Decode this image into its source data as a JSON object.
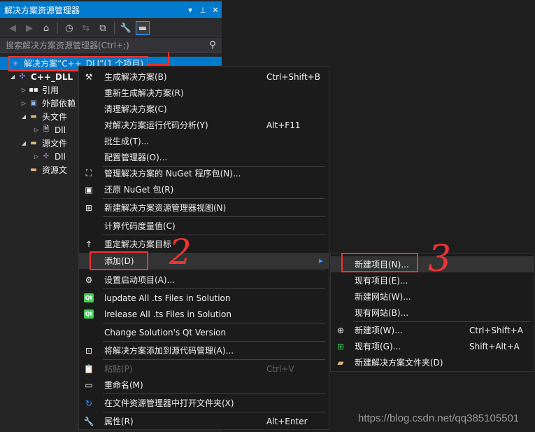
{
  "panel": {
    "title": "解决方案资源管理器",
    "title_buttons": [
      "▾",
      "⊥",
      "✕"
    ],
    "search_placeholder": "搜索解决方案资源管理器(Ctrl+;)"
  },
  "tree": [
    {
      "label": "解决方案“C++_DLL”(1 个项目)",
      "icon": "solution-icon"
    },
    {
      "label": "C++_DLL",
      "icon": "cpp-project-icon"
    },
    {
      "label": "引用",
      "icon": "references-icon"
    },
    {
      "label": "外部依赖",
      "icon": "external-deps-icon"
    },
    {
      "label": "头文件",
      "icon": "folder-icon"
    },
    {
      "label": "Dll",
      "icon": "header-file-icon"
    },
    {
      "label": "源文件",
      "icon": "folder-icon"
    },
    {
      "label": "Dll",
      "icon": "source-file-icon"
    },
    {
      "label": "资源文",
      "icon": "folder-icon"
    }
  ],
  "context_menu": {
    "items": [
      {
        "label": "生成解决方案(B)",
        "shortcut": "Ctrl+Shift+B",
        "icon": "build-icon"
      },
      {
        "label": "重新生成解决方案(R)",
        "shortcut": "",
        "icon": ""
      },
      {
        "label": "清理解决方案(C)",
        "shortcut": "",
        "icon": ""
      },
      {
        "label": "对解决方案运行代码分析(Y)",
        "shortcut": "Alt+F11",
        "icon": ""
      },
      {
        "label": "批生成(T)...",
        "shortcut": "",
        "icon": ""
      },
      {
        "label": "配置管理器(O)...",
        "shortcut": "",
        "icon": ""
      },
      {
        "label": "管理解决方案的 NuGet 程序包(N)...",
        "shortcut": "",
        "icon": "nuget-icon"
      },
      {
        "label": "还原 NuGet 包(R)",
        "shortcut": "",
        "icon": "restore-icon"
      },
      {
        "label": "新建解决方案资源管理器视图(N)",
        "shortcut": "",
        "icon": "new-view-icon"
      },
      {
        "label": "计算代码度量值(C)",
        "shortcut": "",
        "icon": ""
      },
      {
        "label": "重定解决方案目标",
        "shortcut": "",
        "icon": "retarget-icon"
      },
      {
        "label": "添加(D)",
        "shortcut": "",
        "icon": ""
      },
      {
        "label": "设置启动项目(A)...",
        "shortcut": "",
        "icon": "gear-icon"
      },
      {
        "label": "lupdate All .ts Files in Solution",
        "shortcut": "",
        "icon": "qt-icon"
      },
      {
        "label": "lrelease All .ts Files in Solution",
        "shortcut": "",
        "icon": "qt-icon"
      },
      {
        "label": "Change Solution's Qt Version",
        "shortcut": "",
        "icon": ""
      },
      {
        "label": "将解决方案添加到源代码管理(A)...",
        "shortcut": "",
        "icon": "add-source-icon"
      },
      {
        "label": "粘贴(P)",
        "shortcut": "Ctrl+V",
        "icon": "paste-icon"
      },
      {
        "label": "重命名(M)",
        "shortcut": "",
        "icon": "rename-icon"
      },
      {
        "label": "在文件资源管理器中打开文件夹(X)",
        "shortcut": "",
        "icon": "refresh-icon"
      },
      {
        "label": "属性(R)",
        "shortcut": "Alt+Enter",
        "icon": "wrench-icon"
      }
    ]
  },
  "submenu": {
    "items": [
      {
        "label": "新建项目(N)...",
        "shortcut": "",
        "icon": ""
      },
      {
        "label": "现有项目(E)...",
        "shortcut": "",
        "icon": ""
      },
      {
        "label": "新建网站(W)...",
        "shortcut": "",
        "icon": ""
      },
      {
        "label": "现有网站(B)...",
        "shortcut": "",
        "icon": ""
      },
      {
        "label": "新建项(W)...",
        "shortcut": "Ctrl+Shift+A",
        "icon": "new-item-icon"
      },
      {
        "label": "现有项(G)...",
        "shortcut": "Shift+Alt+A",
        "icon": "existing-item-icon"
      },
      {
        "label": "新建解决方案文件夹(D)",
        "shortcut": "",
        "icon": "new-folder-icon"
      }
    ]
  },
  "annotations": {
    "step2": "2",
    "step3": "3"
  },
  "watermark": "https://blog.csdn.net/qq385105501",
  "colors": {
    "accent": "#007acc",
    "highlight": "#e33333",
    "qt_green": "#41cd52"
  }
}
